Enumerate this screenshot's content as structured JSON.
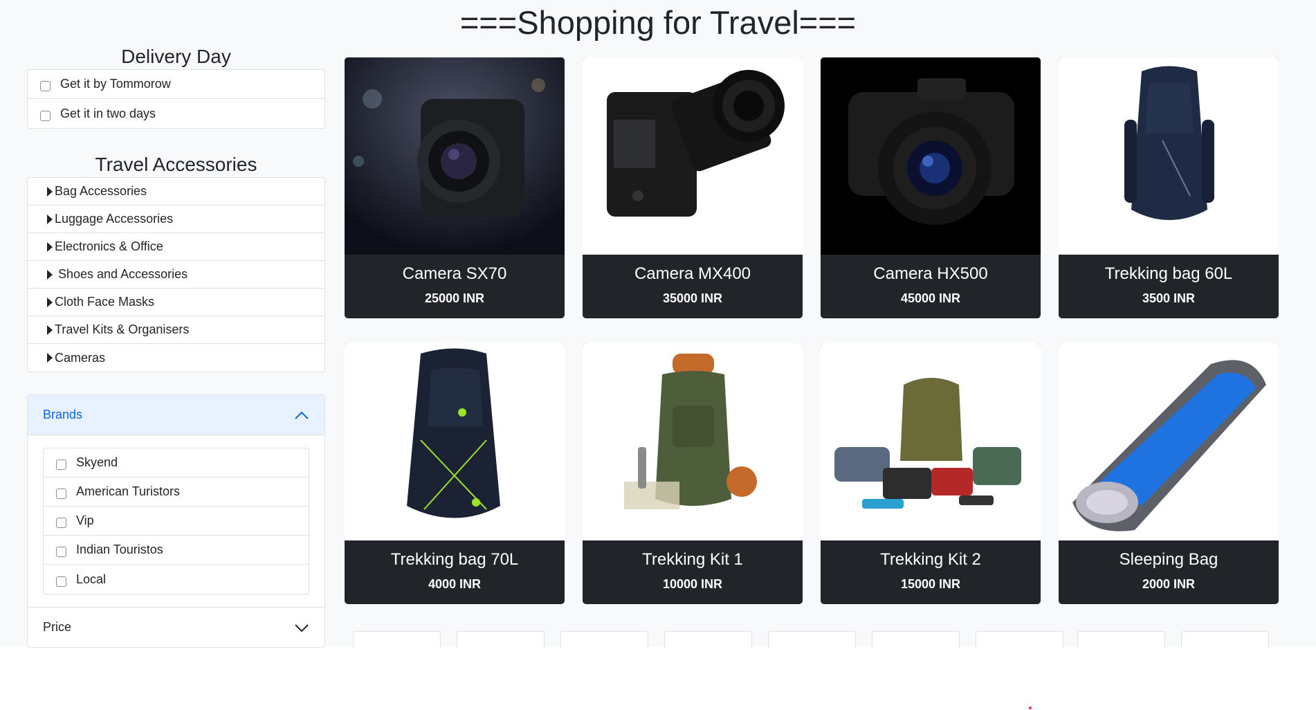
{
  "header": {
    "title": "===Shopping for Travel==="
  },
  "delivery": {
    "title": "Delivery Day",
    "options": [
      "Get it by Tommorow",
      "Get it in two days"
    ]
  },
  "accessories": {
    "title": "Travel Accessories",
    "items": [
      "Bag Accessories",
      "Luggage Accessories",
      "Electronics & Office",
      "Shoes and Accessories",
      "Cloth Face Masks",
      "Travel Kits & Organisers",
      "Cameras"
    ]
  },
  "filters": {
    "brands_label": "Brands",
    "brands": [
      "Skyend",
      "American Turistors",
      "Vip",
      "Indian Touristos",
      "Local"
    ],
    "price_label": "Price",
    "brands_expanded": true,
    "price_expanded": false,
    "accent_color": "#0c63e4"
  },
  "products": [
    {
      "name": "Camera SX70",
      "price": "25000 INR",
      "icon": "camera-icon"
    },
    {
      "name": "Camera MX400",
      "price": "35000 INR",
      "icon": "camera-icon"
    },
    {
      "name": "Camera HX500",
      "price": "45000 INR",
      "icon": "camera-icon"
    },
    {
      "name": "Trekking bag 60L",
      "price": "3500 INR",
      "icon": "backpack-icon"
    },
    {
      "name": "Trekking bag 70L",
      "price": "4000 INR",
      "icon": "backpack-icon"
    },
    {
      "name": "Trekking Kit 1",
      "price": "10000 INR",
      "icon": "backpack-icon"
    },
    {
      "name": "Trekking Kit 2",
      "price": "15000 INR",
      "icon": "gear-kit-icon"
    },
    {
      "name": "Sleeping Bag",
      "price": "2000 INR",
      "icon": "sleeping-bag-icon"
    }
  ],
  "colors": {
    "card_bg": "#212529",
    "page_bg": "#f8f9fa",
    "text": "#212529"
  }
}
